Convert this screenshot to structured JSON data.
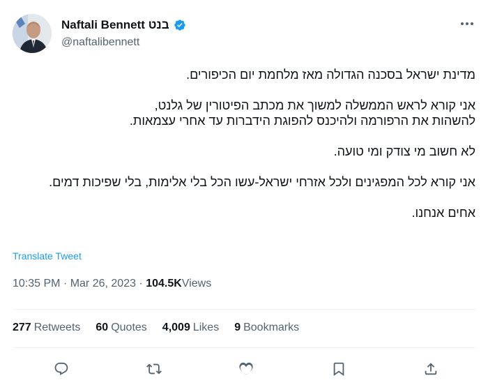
{
  "author": {
    "display_name": "Naftali Bennett בנט",
    "handle": "@naftalibennett"
  },
  "tweet": {
    "paragraphs": [
      "מדינת ישראל בסכנה הגדולה מאז מלחמת יום הכיפורים.",
      "אני קורא לראש הממשלה למשוך את מכתב הפיטורין של גלנט,\nלהשהות את הרפורמה ולהיכנס להפוגת הידברות עד אחרי עצמאות.",
      "לא חשוב מי צודק ומי טועה.",
      "אני קורא לכל המפגינים ולכל אזרחי ישראל-עשו הכל בלי אלימות, בלי שפיכות דמים.",
      "אחים אנחנו."
    ],
    "translate_label": "Translate Tweet",
    "time": "10:35 PM",
    "date": "Mar 26, 2023",
    "views_count": "104.5K",
    "views_label": "Views"
  },
  "stats": {
    "retweets_count": "277",
    "retweets_label": "Retweets",
    "quotes_count": "60",
    "quotes_label": "Quotes",
    "likes_count": "4,009",
    "likes_label": "Likes",
    "bookmarks_count": "9",
    "bookmarks_label": "Bookmarks"
  },
  "icons": {
    "more": "more-icon",
    "verified": "verified-badge-icon",
    "reply": "reply-icon",
    "retweet": "retweet-icon",
    "like": "like-icon",
    "bookmark": "bookmark-icon",
    "share": "share-icon"
  },
  "colors": {
    "accent": "#1d9bf0",
    "secondary_text": "#536471",
    "primary_text": "#0f1419"
  }
}
